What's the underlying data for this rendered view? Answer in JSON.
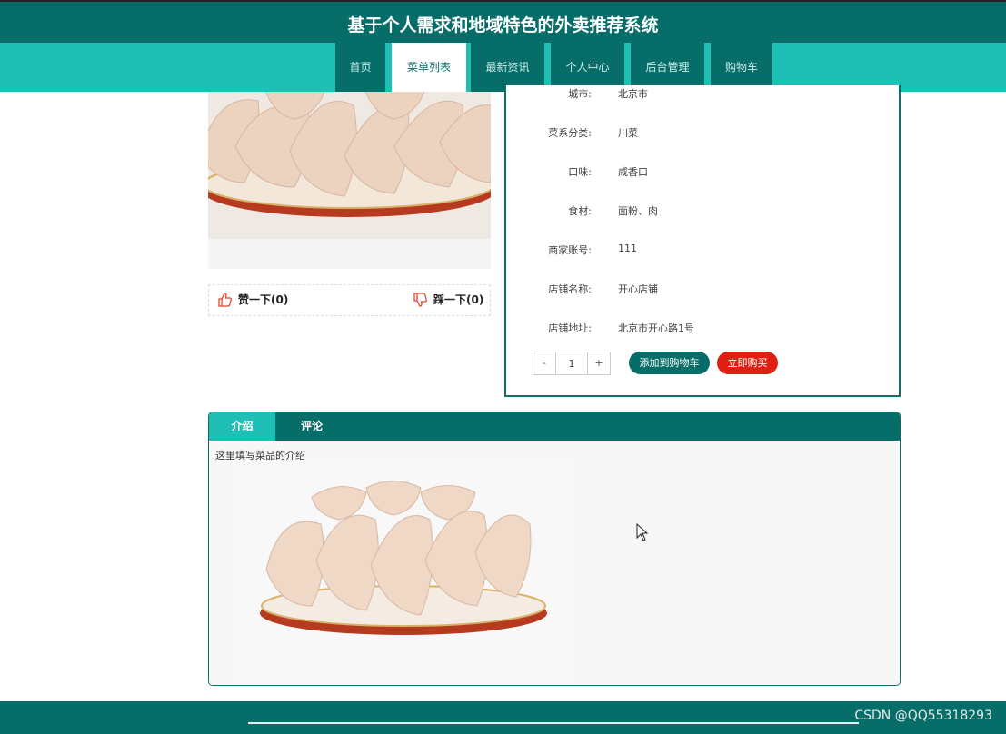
{
  "header": {
    "title": "基于个人需求和地域特色的外卖推荐系统"
  },
  "nav": [
    {
      "label": "首页"
    },
    {
      "label": "菜单列表"
    },
    {
      "label": "最新资讯"
    },
    {
      "label": "个人中心"
    },
    {
      "label": "后台管理"
    },
    {
      "label": "购物车"
    }
  ],
  "nav_active": "菜单列表",
  "votes": {
    "like": "赞一下(0)",
    "dislike": "踩一下(0)"
  },
  "info": {
    "rows": [
      {
        "label": "城市:",
        "value": "北京市"
      },
      {
        "label": "菜系分类:",
        "value": "川菜"
      },
      {
        "label": "口味:",
        "value": "咸香口"
      },
      {
        "label": "食材:",
        "value": "面粉、肉"
      },
      {
        "label": "商家账号:",
        "value": "111"
      },
      {
        "label": "店铺名称:",
        "value": "开心店铺"
      },
      {
        "label": "店铺地址:",
        "value": "北京市开心路1号"
      }
    ]
  },
  "quantity": {
    "minus": "-",
    "value": "1",
    "plus": "+"
  },
  "buttons": {
    "add_to_cart": "添加到购物车",
    "buy_now": "立即购买"
  },
  "tabs": [
    {
      "label": "介绍"
    },
    {
      "label": "评论"
    }
  ],
  "tab_active": "介绍",
  "intro": {
    "text": "这里填写菜品的介绍"
  },
  "footer": {
    "watermark": "CSDN @QQ55318293"
  },
  "colors": {
    "primary": "#066d68",
    "accent": "#1fbfb5",
    "buy": "#e01e12",
    "vote_icon": "#e0452e"
  }
}
